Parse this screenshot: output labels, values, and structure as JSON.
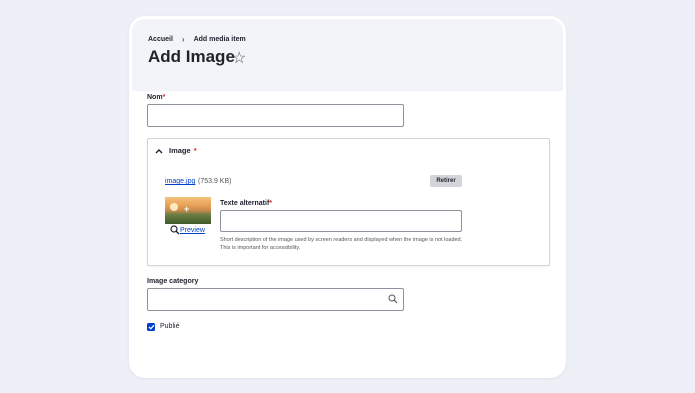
{
  "breadcrumb": {
    "home": "Accueil",
    "separator": "›",
    "current": "Add media item"
  },
  "page": {
    "title": "Add Image"
  },
  "form": {
    "name": {
      "label": "Nom",
      "required": "*",
      "value": ""
    },
    "image": {
      "summary_label": "Image",
      "required": "*",
      "file_name": "image.jpg",
      "file_size": "(753.9 KB)",
      "remove_label": "Retirer",
      "preview_label": "Preview",
      "alt": {
        "label": "Texte alternatif",
        "required": "*",
        "value": "",
        "help": "Short description of the image used by screen readers and displayed when the image is not loaded. This is important for accessibility."
      }
    },
    "category": {
      "label": "Image category",
      "value": ""
    },
    "published": {
      "label": "Publié",
      "checked": true
    }
  },
  "icons": {
    "favorite": "star-icon",
    "collapse": "chevron-up-icon",
    "search": "search-icon",
    "zoom": "magnifier-icon",
    "check": "check-icon"
  },
  "colors": {
    "accent": "#003ecc",
    "required": "#dc2323",
    "header_bg": "#f3f4f9",
    "page_bg": "#eef0f8"
  }
}
